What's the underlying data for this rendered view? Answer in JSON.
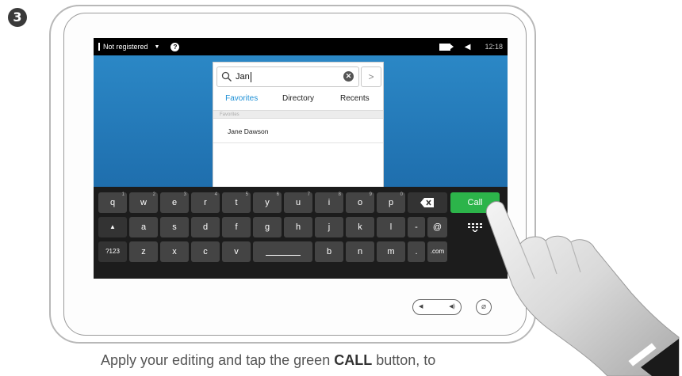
{
  "step_number": "3",
  "status_bar": {
    "registration": "Not registered",
    "time": "12:18"
  },
  "search": {
    "query": "Jan"
  },
  "tabs": [
    {
      "label": "Favorites",
      "active": true
    },
    {
      "label": "Directory",
      "active": false
    },
    {
      "label": "Recents",
      "active": false
    }
  ],
  "section_header": "Favorites",
  "contacts": [
    "Jane Dawson"
  ],
  "keyboard": {
    "row1": [
      {
        "key": "q",
        "sup": "1"
      },
      {
        "key": "w",
        "sup": "2"
      },
      {
        "key": "e",
        "sup": "3"
      },
      {
        "key": "r",
        "sup": "4"
      },
      {
        "key": "t",
        "sup": "5"
      },
      {
        "key": "y",
        "sup": "6"
      },
      {
        "key": "u",
        "sup": "7"
      },
      {
        "key": "i",
        "sup": "8"
      },
      {
        "key": "o",
        "sup": "9"
      },
      {
        "key": "p",
        "sup": "0"
      }
    ],
    "row2": [
      "a",
      "s",
      "d",
      "f",
      "g",
      "h",
      "j",
      "k",
      "l",
      "-",
      "@"
    ],
    "row3": {
      "mode_label": "?123",
      "left": [
        "z",
        "x",
        "c",
        "v"
      ],
      "right": [
        "b",
        "n",
        "m",
        "."
      ],
      "com_label": ".com"
    },
    "call_label": "Call"
  },
  "caption": {
    "before": "Apply your editing and tap the green ",
    "emphasis": "CALL",
    "after": " button, to"
  },
  "colors": {
    "call_green": "#2cb44a",
    "active_tab_blue": "#1e90d6",
    "screen_blue": "#2d8bc9"
  }
}
